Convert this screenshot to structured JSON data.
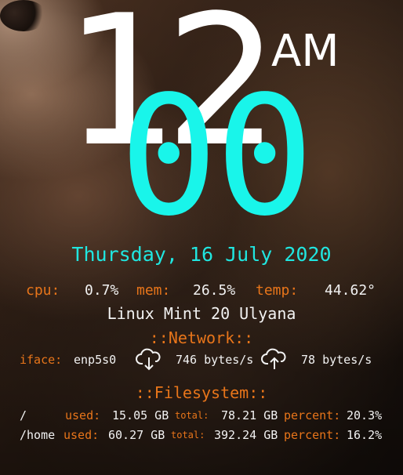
{
  "clock": {
    "hour": "12",
    "minute": "00",
    "ampm": "AM"
  },
  "date": "Thursday, 16 July 2020",
  "stats": {
    "cpu_label": "cpu:",
    "cpu_value": "0.7%",
    "mem_label": "mem:",
    "mem_value": "26.5%",
    "temp_label": "temp:",
    "temp_value": "44.62°"
  },
  "os": "Linux Mint 20 Ulyana",
  "network": {
    "title": "Network",
    "iface_label": "iface:",
    "iface_value": "enp5s0",
    "down": "746 bytes/s",
    "up": "78 bytes/s",
    "down_icon": "cloud-download-icon",
    "up_icon": "cloud-upload-icon"
  },
  "filesystem": {
    "title": "Filesystem",
    "used_label": "used:",
    "total_label": "total:",
    "percent_label": "percent:",
    "rows": [
      {
        "mount": "/",
        "used": "15.05 GB",
        "total": "78.21 GB",
        "percent": "20.3%"
      },
      {
        "mount": "/home",
        "used": "60.27 GB",
        "total": "392.24 GB",
        "percent": "16.2%"
      }
    ]
  },
  "colors": {
    "accent_cyan": "#19f5ea",
    "label_orange": "#e8751a",
    "text_white": "#f2f2f2"
  }
}
